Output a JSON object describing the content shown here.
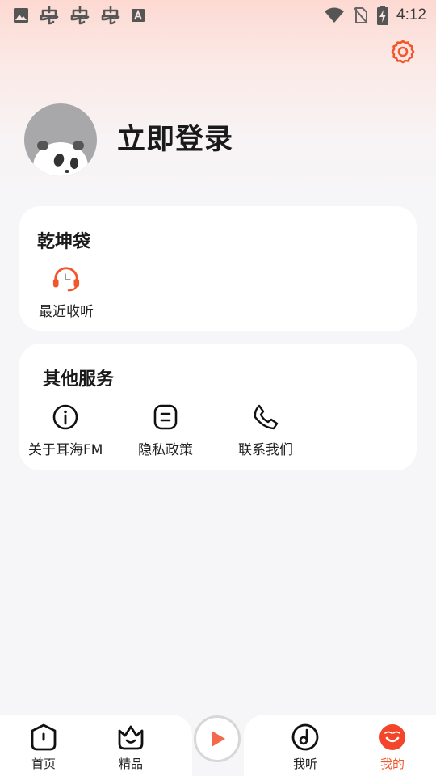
{
  "status_bar": {
    "time": "4:12",
    "left_icons": [
      "image-icon",
      "app-bug-icon",
      "app-bug-icon",
      "app-bug-icon",
      "font-icon"
    ],
    "right_icons": [
      "wifi-icon",
      "no-sim-icon",
      "battery-charging-icon"
    ]
  },
  "header": {
    "settings_icon": "gear-icon",
    "login_label": "立即登录",
    "avatar_icon": "panda-avatar-icon"
  },
  "treasure_bag": {
    "title": "乾坤袋",
    "items": [
      {
        "label": "最近收听",
        "icon": "headphones-clock-icon"
      }
    ]
  },
  "other_services": {
    "title": "其他服务",
    "items": [
      {
        "label": "关于耳海FM",
        "icon": "info-icon"
      },
      {
        "label": "隐私政策",
        "icon": "document-icon"
      },
      {
        "label": "联系我们",
        "icon": "phone-icon"
      }
    ]
  },
  "bottom_nav": {
    "items": [
      {
        "label": "首页",
        "icon": "home-icon"
      },
      {
        "label": "精品",
        "icon": "crown-icon"
      },
      {
        "label": "我听",
        "icon": "music-note-icon"
      },
      {
        "label": "我的",
        "icon": "smile-face-icon"
      }
    ],
    "play_icon": "play-icon",
    "active_index": 3
  },
  "colors": {
    "accent": "#f2562d",
    "background": "#f6f6f8",
    "card": "#ffffff"
  }
}
